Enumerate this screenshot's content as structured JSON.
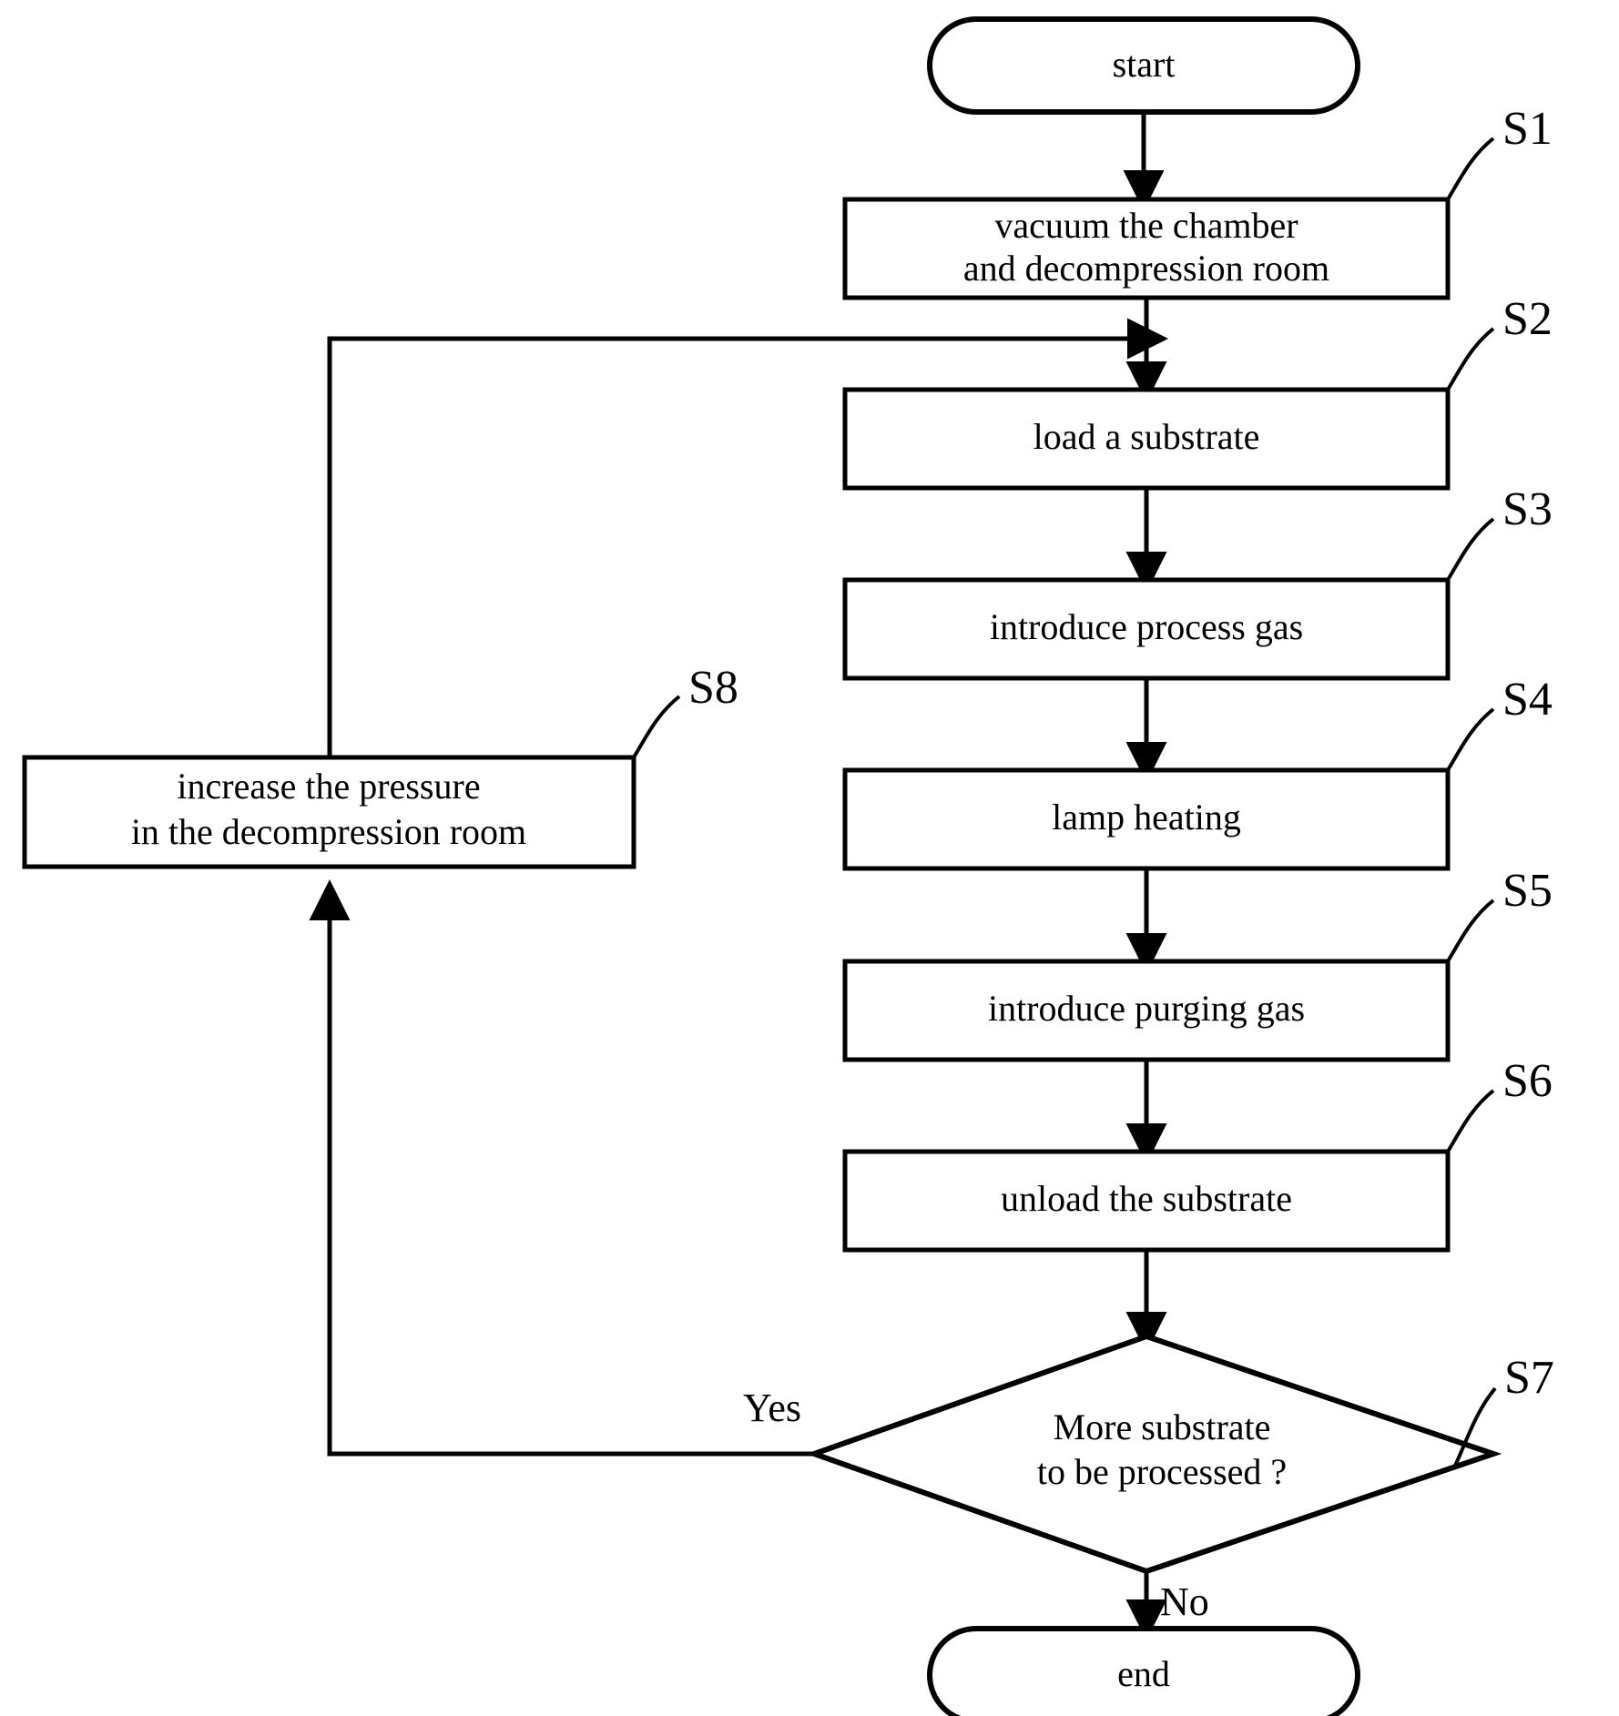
{
  "diagram": {
    "type": "flowchart",
    "title": "substrate processing flowchart",
    "orientation": "top-to-bottom",
    "stroke_color": "#000000",
    "background_color": "#ffffff",
    "terminators": {
      "start": "start",
      "end": "end"
    },
    "steps": [
      {
        "id": "S1",
        "label": "S1",
        "line1": "vacuum the chamber",
        "line2": "and decompression room"
      },
      {
        "id": "S2",
        "label": "S2",
        "line1": "load a substrate",
        "line2": ""
      },
      {
        "id": "S3",
        "label": "S3",
        "line1": "introduce process gas",
        "line2": ""
      },
      {
        "id": "S4",
        "label": "S4",
        "line1": "lamp heating",
        "line2": ""
      },
      {
        "id": "S5",
        "label": "S5",
        "line1": "introduce purging gas",
        "line2": ""
      },
      {
        "id": "S6",
        "label": "S6",
        "line1": "unload the substrate",
        "line2": ""
      }
    ],
    "decision": {
      "id": "S7",
      "label": "S7",
      "line1": "More substrate",
      "line2": "to be processed ?",
      "yes_branch": "Yes",
      "no_branch": "No"
    },
    "feedback_step": {
      "id": "S8",
      "label": "S8",
      "line1": "increase the pressure",
      "line2": "in the decompression room"
    }
  }
}
